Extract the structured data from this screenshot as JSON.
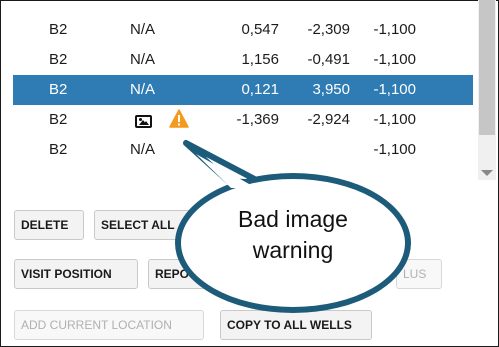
{
  "table": {
    "rows": [
      {
        "well": "B2",
        "status": "N/A",
        "x": "0,547",
        "y": "-2,309",
        "z": "-1,100",
        "selected": false
      },
      {
        "well": "B2",
        "status": "N/A",
        "x": "1,156",
        "y": "-0,491",
        "z": "-1,100",
        "selected": false
      },
      {
        "well": "B2",
        "status": "N/A",
        "x": "0,121",
        "y": "3,950",
        "z": "-1,100",
        "selected": true
      },
      {
        "well": "B2",
        "status_icons": [
          "image-icon",
          "warning-icon"
        ],
        "x": "-1,369",
        "y": "-2,924",
        "z": "-1,100",
        "selected": false
      },
      {
        "well": "B2",
        "status": "N/A",
        "z": "-1,100",
        "selected": false
      }
    ]
  },
  "buttons": {
    "delete": "DELETE",
    "select_all": "SELECT ALL",
    "visit_position": "VISIT POSITION",
    "reposition": "REPOS",
    "plus": "LUS",
    "add_current_location": "ADD CURRENT LOCATION",
    "copy_to_all_wells": "COPY TO ALL WELLS"
  },
  "callout": {
    "line1": "Bad image",
    "line2": "warning"
  },
  "colors": {
    "selection": "#2f7cb4",
    "callout_border": "#1c5b7a",
    "warning": "#f39a1f"
  }
}
